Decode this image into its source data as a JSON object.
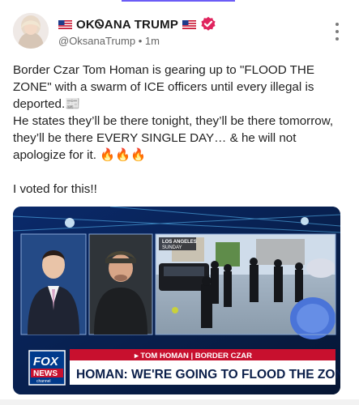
{
  "post": {
    "author_name": "OKᏫANA TRUMP",
    "handle": "@OksanaTrump",
    "separator": "•",
    "time": "1m",
    "text_p1": "Border Czar Tom Homan is gearing up to \"FLOOD THE ZONE\" with a swarm of ICE officers until every illegal is deported.📰\nHe states they’ll be there tonight, they’ll be there tomorrow, they’ll be there EVERY SINGLE DAY… & he will not apologize for it. 🔥🔥🔥",
    "text_p2": "I voted for this!!"
  },
  "icons": {
    "flag_left": "us-flag-icon",
    "flag_right": "us-flag-icon",
    "verified": "verified-badge-icon",
    "more": "more-vertical-icon"
  },
  "media": {
    "location_tag_line1": "LOS ANGELES",
    "location_tag_line2": "SUNDAY",
    "lower_third_label": "▸ TOM HOMAN | BORDER CZAR",
    "headline": "HOMAN: WE'RE GOING TO FLOOD THE ZONE",
    "network_line1": "FOX",
    "network_line2": "NEWS",
    "network_sub": "channel"
  },
  "colors": {
    "verified": "#e0245e",
    "fox_red": "#c8102e",
    "fox_blue": "#003a8c"
  }
}
